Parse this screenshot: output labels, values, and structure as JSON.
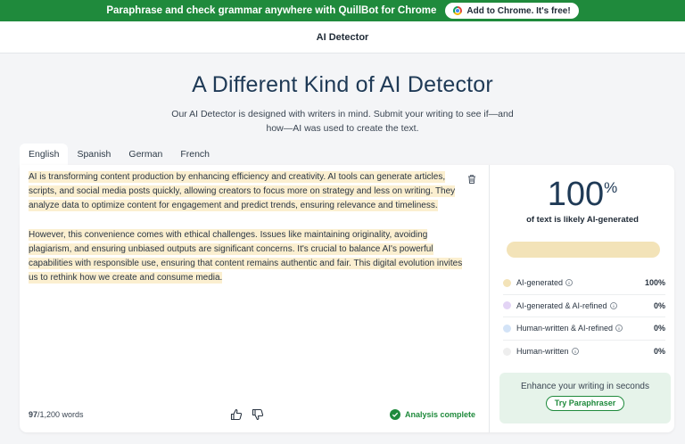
{
  "banner": {
    "text": "Paraphrase and check grammar anywhere with QuillBot for Chrome",
    "button_label": "Add to Chrome. It's free!"
  },
  "topbar": {
    "title": "AI Detector"
  },
  "hero": {
    "title": "A Different Kind of AI Detector",
    "subtitle_line1": "Our AI Detector is designed with writers in mind. Submit your writing to see if—and",
    "subtitle_line2": "how—AI was used to create the text."
  },
  "tabs": [
    {
      "label": "English",
      "active": true
    },
    {
      "label": "Spanish",
      "active": false
    },
    {
      "label": "German",
      "active": false
    },
    {
      "label": "French",
      "active": false
    }
  ],
  "editor": {
    "paragraphs": [
      "AI is transforming content production by enhancing efficiency and creativity. AI tools can generate articles, scripts, and social media posts quickly, allowing creators to focus more on strategy and less on writing. They analyze data to optimize content for engagement and predict trends, ensuring relevance and timeliness.",
      "However, this convenience comes with ethical challenges. Issues like maintaining originality, avoiding plagiarism, and ensuring unbiased outputs are significant concerns. It's crucial to balance AI's powerful capabilities with responsible use, ensuring that content remains authentic and fair. This digital evolution invites us to rethink how we create and consume media."
    ],
    "word_count": "97",
    "word_limit": "/1,200 words",
    "status": "Analysis complete",
    "highlight_color": "#fbefd0"
  },
  "results": {
    "score": "100",
    "score_unit": "%",
    "score_label": "of text is likely AI-generated",
    "bar_ai_fraction": 1.0,
    "legend": [
      {
        "label": "AI-generated",
        "value": "100%",
        "color": "#f3e3b8"
      },
      {
        "label": "AI-generated & AI-refined",
        "value": "0%",
        "color": "#e3d4f5"
      },
      {
        "label": "Human-written & AI-refined",
        "value": "0%",
        "color": "#d3e3f7"
      },
      {
        "label": "Human-written",
        "value": "0%",
        "color": "#eeeeee"
      }
    ],
    "promo_text": "Enhance your writing in seconds",
    "promo_button": "Try Paraphraser"
  },
  "colors": {
    "brand_green": "#1f8a3c",
    "title_blue": "#1f3a56"
  }
}
